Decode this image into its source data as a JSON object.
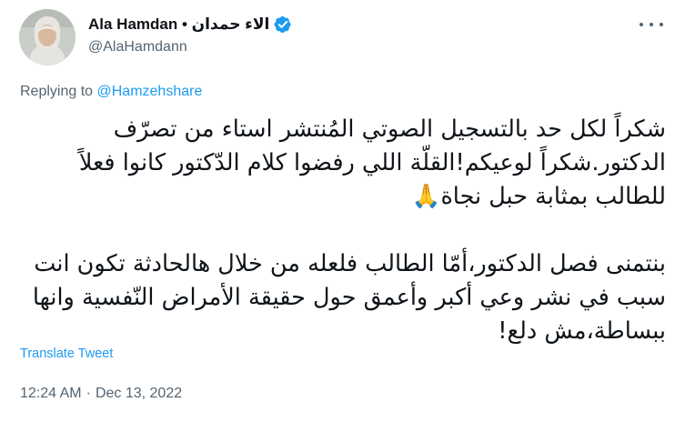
{
  "author": {
    "display_name": "Ala Hamdan • الاء حمدان",
    "handle": "@AlaHamdann",
    "verified": true
  },
  "reply": {
    "prefix": "Replying to ",
    "to_handle": "@Hamzehshare"
  },
  "tweet": {
    "paragraph_1": "شكراً لكل حد بالتسجيل الصوتي المُنتشر استاء من تصرّف الدكتور.شكراً لوعيكم!القلّة اللي رفضوا كلام الدّكتور كانوا فعلاً للطالب بمثابة حبل نجاة🙏",
    "paragraph_2": "بنتمنى فصل الدكتور،أمّا الطالب فلعله من خلال هالحادثة تكون انت سبب في نشر وعي أكبر وأعمق حول حقيقة الأمراض النّفسية وانها ببساطة،مش دلع!"
  },
  "translate_label": "Translate Tweet",
  "meta": {
    "time": "12:24 AM",
    "separator": "·",
    "date": "Dec 13, 2022"
  },
  "colors": {
    "accent": "#1d9bf0",
    "secondary_text": "#536471",
    "primary_text": "#0f1419"
  },
  "icons": {
    "verified": "verified-badge-icon",
    "more": "more-options-icon"
  }
}
